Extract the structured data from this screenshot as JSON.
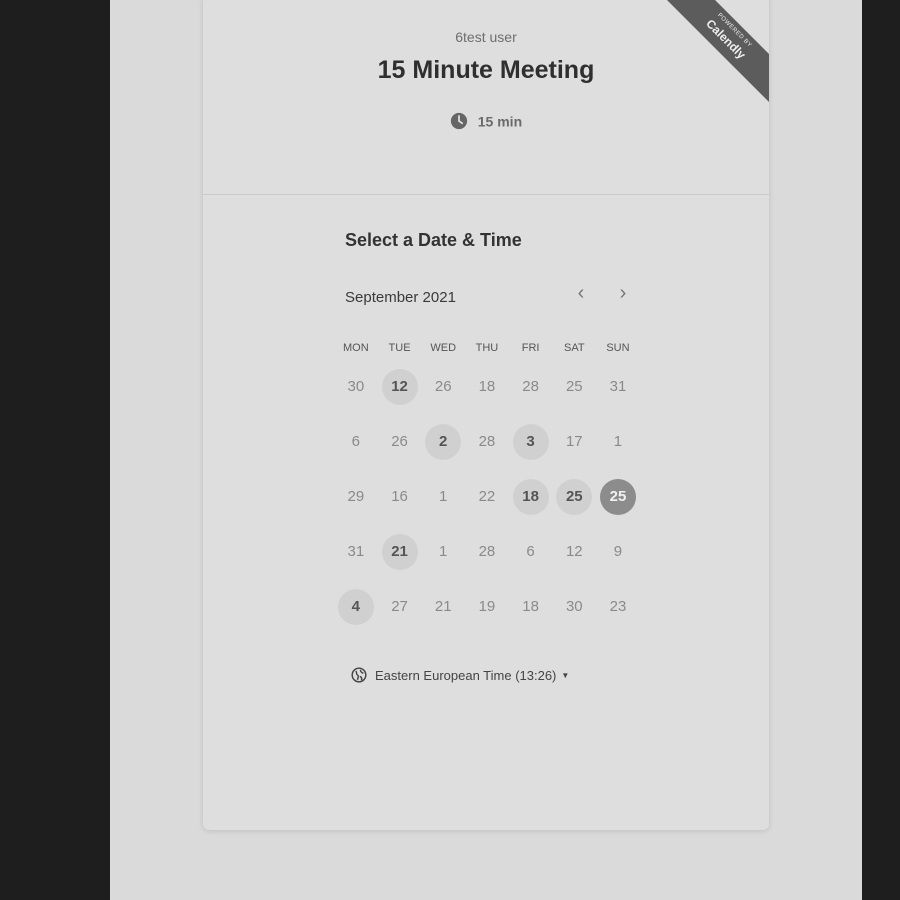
{
  "header": {
    "organizer": "6test user",
    "event_title": "15 Minute Meeting",
    "duration": "15 min",
    "ribbon_small": "POWERED BY",
    "ribbon_brand": "Calendly"
  },
  "calendar": {
    "section_title": "Select a Date & Time",
    "month": "September 2021",
    "prev_icon": "‹",
    "next_icon": "›",
    "weekdays": [
      "MON",
      "TUE",
      "WED",
      "THU",
      "FRI",
      "SAT",
      "SUN"
    ],
    "weeks": [
      [
        {
          "label": "30",
          "state": "unavailable"
        },
        {
          "label": "12",
          "state": "available"
        },
        {
          "label": "26",
          "state": "unavailable"
        },
        {
          "label": "18",
          "state": "unavailable"
        },
        {
          "label": "28",
          "state": "unavailable"
        },
        {
          "label": "25",
          "state": "unavailable"
        },
        {
          "label": "31",
          "state": "unavailable"
        }
      ],
      [
        {
          "label": "6",
          "state": "unavailable"
        },
        {
          "label": "26",
          "state": "unavailable"
        },
        {
          "label": "2",
          "state": "available"
        },
        {
          "label": "28",
          "state": "unavailable"
        },
        {
          "label": "3",
          "state": "available"
        },
        {
          "label": "17",
          "state": "unavailable"
        },
        {
          "label": "1",
          "state": "unavailable"
        }
      ],
      [
        {
          "label": "29",
          "state": "unavailable"
        },
        {
          "label": "16",
          "state": "unavailable"
        },
        {
          "label": "1",
          "state": "unavailable"
        },
        {
          "label": "22",
          "state": "unavailable"
        },
        {
          "label": "18",
          "state": "available"
        },
        {
          "label": "25",
          "state": "available"
        },
        {
          "label": "25",
          "state": "selected"
        }
      ],
      [
        {
          "label": "31",
          "state": "unavailable"
        },
        {
          "label": "21",
          "state": "available"
        },
        {
          "label": "1",
          "state": "unavailable"
        },
        {
          "label": "28",
          "state": "unavailable"
        },
        {
          "label": "6",
          "state": "unavailable"
        },
        {
          "label": "12",
          "state": "unavailable"
        },
        {
          "label": "9",
          "state": "unavailable"
        }
      ],
      [
        {
          "label": "4",
          "state": "available"
        },
        {
          "label": "27",
          "state": "unavailable"
        },
        {
          "label": "21",
          "state": "unavailable"
        },
        {
          "label": "19",
          "state": "unavailable"
        },
        {
          "label": "18",
          "state": "unavailable"
        },
        {
          "label": "30",
          "state": "unavailable"
        },
        {
          "label": "23",
          "state": "unavailable"
        }
      ]
    ]
  },
  "timezone": {
    "label": "Eastern European Time (13:26)",
    "caret_icon": "▼"
  },
  "colors": {
    "outer_background": "#1e1e1e",
    "page_background": "#dadada",
    "card_background": "#dedede",
    "available_day": "#d0d0d0",
    "selected_day": "#8c8c8c",
    "ribbon": "#5c5c5c"
  }
}
